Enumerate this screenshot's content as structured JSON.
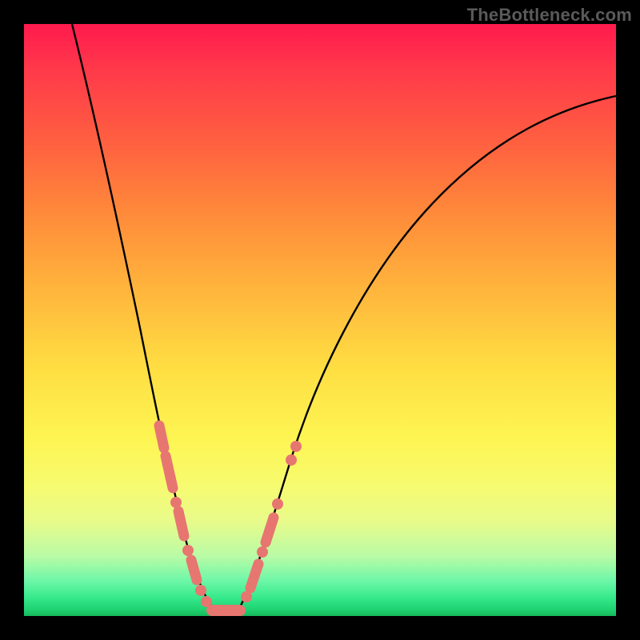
{
  "watermark": "TheBottleneck.com",
  "colors": {
    "gradient_top": "#ff1a4d",
    "gradient_bottom": "#16b85a",
    "curve": "#000000",
    "marker": "#e77671",
    "frame": "#000000"
  },
  "chart_data": {
    "type": "line",
    "title": "",
    "xlabel": "",
    "ylabel": "",
    "xlim": [
      0,
      100
    ],
    "ylim": [
      0,
      100
    ],
    "x": [
      10,
      11,
      12,
      13,
      14,
      15,
      16,
      17,
      18,
      19,
      20,
      21,
      22,
      23,
      24,
      25,
      26,
      27,
      28,
      29,
      30,
      32,
      34,
      36,
      38,
      40,
      44,
      48,
      52,
      56,
      60,
      65,
      70,
      75,
      80,
      85,
      90,
      95,
      99
    ],
    "y": [
      100,
      94,
      88,
      82,
      77,
      72,
      67,
      62,
      57,
      52,
      48,
      44,
      40,
      36,
      32,
      28,
      24,
      20,
      16,
      10,
      4,
      0,
      0,
      2,
      8,
      14,
      22,
      32,
      40,
      48,
      54,
      60,
      65,
      70,
      74,
      77,
      80,
      83,
      85
    ],
    "legend": [],
    "grid": false,
    "annotations": [
      {
        "type": "marker_cluster",
        "x_range": [
          20,
          35
        ],
        "description": "pink rounded markers clustered near valley along both slopes"
      }
    ]
  }
}
